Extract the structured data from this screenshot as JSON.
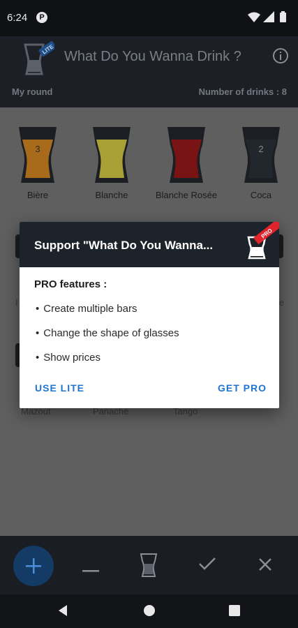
{
  "status_bar": {
    "time": "6:24",
    "notification_badge": "P"
  },
  "app_bar": {
    "title": "What Do You Wanna Drink ?",
    "logo_badge": "LITE",
    "info_icon": "info-icon",
    "my_round_label": "My round",
    "drink_count_label": "Number of drinks : 8"
  },
  "drinks_row1": [
    {
      "name": "Bière",
      "count": "3",
      "color": "#a86b1c"
    },
    {
      "name": "Blanche",
      "count": "",
      "color": "#a9a035"
    },
    {
      "name": "Blanche Rosée",
      "count": "",
      "color": "#7a1414"
    },
    {
      "name": "Coca",
      "count": "2",
      "color": "#1b1e22"
    }
  ],
  "drinks_row2_partial": [
    "I",
    "e"
  ],
  "drinks_row3": [
    "Mazout",
    "Panaché",
    "Tango"
  ],
  "dialog": {
    "title": "Support \"What Do You Wanna...",
    "logo_badge": "PRO",
    "heading": "PRO features :",
    "features": [
      "Create multiple bars",
      "Change the shape of glasses",
      "Show prices"
    ],
    "bullet": "•",
    "use_lite_label": "USE LITE",
    "get_pro_label": "GET PRO",
    "accent_color": "#1e74d3"
  },
  "bottom_bar": {
    "items": [
      "add-icon",
      "minus-icon",
      "glass-icon",
      "check-icon",
      "close-icon"
    ]
  },
  "nav_bar": {
    "items": [
      "back-icon",
      "home-icon",
      "recents-icon"
    ]
  }
}
